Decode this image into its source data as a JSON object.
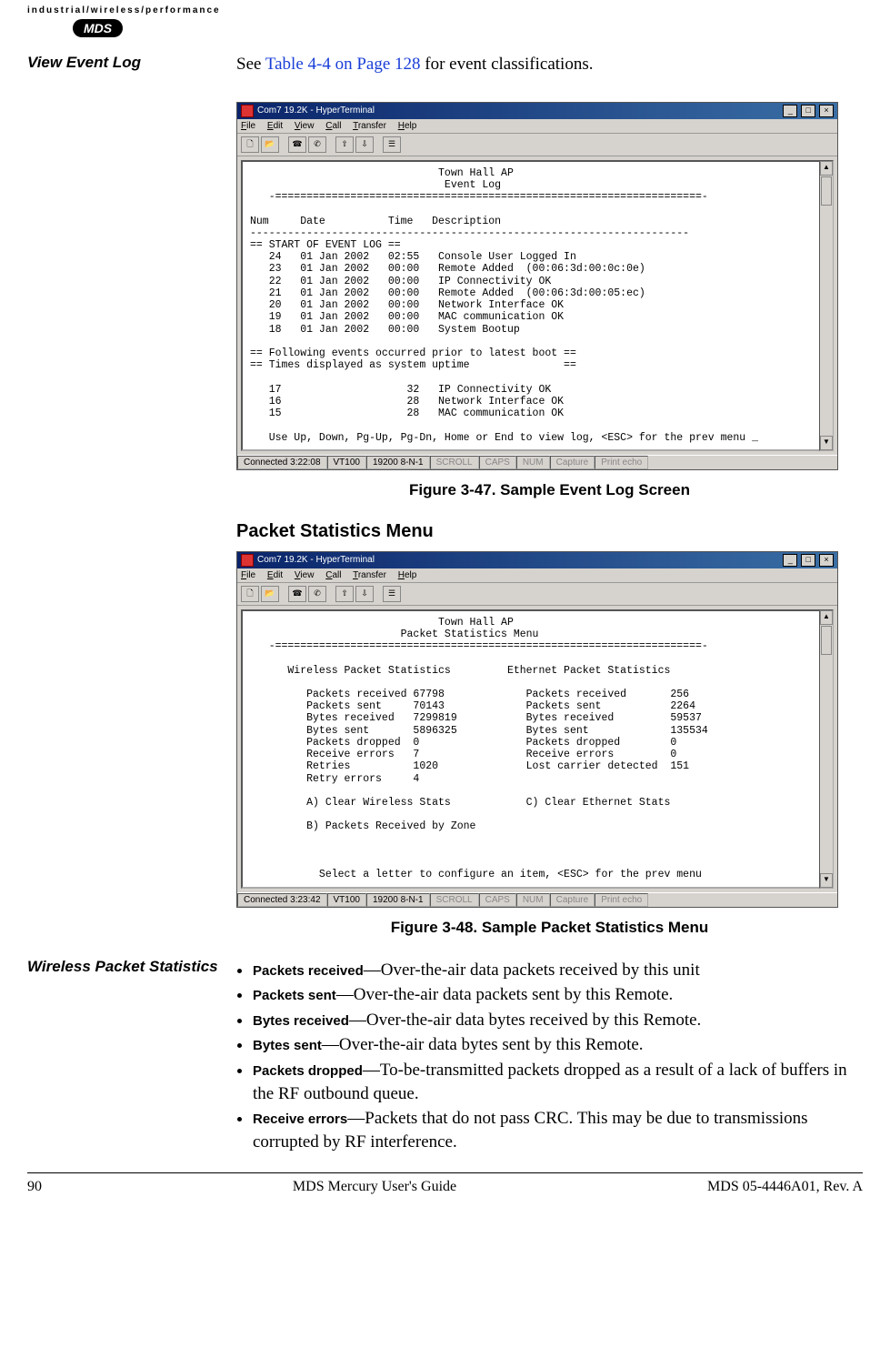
{
  "brand_line": "industrial/wireless/performance",
  "logo": "MDS",
  "side": {
    "view_event_log": "View Event Log",
    "wireless_packet_stats": "Wireless Packet Statistics"
  },
  "intro": {
    "see": "See ",
    "link": "Table 4-4 on Page 128",
    "rest": " for event classifications."
  },
  "window": {
    "title": "Com7 19.2K - HyperTerminal",
    "menu": {
      "file": "File",
      "edit": "Edit",
      "view": "View",
      "call": "Call",
      "transfer": "Transfer",
      "help": "Help"
    },
    "win_btns": {
      "min": "_",
      "max": "□",
      "close": "×"
    },
    "scroll": {
      "up": "▲",
      "down": "▼"
    }
  },
  "status1": {
    "conn": "Connected 3:22:08",
    "emu": "VT100",
    "port": "19200 8-N-1",
    "scroll": "SCROLL",
    "caps": "CAPS",
    "num": "NUM",
    "capture": "Capture",
    "echo": "Print echo"
  },
  "status2": {
    "conn": "Connected 3:23:42",
    "emu": "VT100",
    "port": "19200 8-N-1",
    "scroll": "SCROLL",
    "caps": "CAPS",
    "num": "NUM",
    "capture": "Capture",
    "echo": "Print echo"
  },
  "event_log_screen": "                              Town Hall AP\n                               Event Log\n   -====================================================================-\n\nNum     Date          Time   Description\n----------------------------------------------------------------------\n== START OF EVENT LOG ==\n   24   01 Jan 2002   02:55   Console User Logged In\n   23   01 Jan 2002   00:00   Remote Added  (00:06:3d:00:0c:0e)\n   22   01 Jan 2002   00:00   IP Connectivity OK\n   21   01 Jan 2002   00:00   Remote Added  (00:06:3d:00:05:ec)\n   20   01 Jan 2002   00:00   Network Interface OK\n   19   01 Jan 2002   00:00   MAC communication OK\n   18   01 Jan 2002   00:00   System Bootup\n\n== Following events occurred prior to latest boot ==\n== Times displayed as system uptime               ==\n\n   17                    32   IP Connectivity OK\n   16                    28   Network Interface OK\n   15                    28   MAC communication OK\n\n   Use Up, Down, Pg-Up, Pg-Dn, Home or End to view log, <ESC> for the prev menu _",
  "figure1_caption": "Figure 3-47. Sample Event Log Screen",
  "section_packet": "Packet Statistics Menu",
  "packet_stats_screen": "                              Town Hall AP\n                        Packet Statistics Menu\n   -====================================================================-\n\n      Wireless Packet Statistics         Ethernet Packet Statistics\n\n         Packets received 67798             Packets received       256\n         Packets sent     70143             Packets sent           2264\n         Bytes received   7299819           Bytes received         59537\n         Bytes sent       5896325           Bytes sent             135534\n         Packets dropped  0                 Packets dropped        0\n         Receive errors   7                 Receive errors         0\n         Retries          1020              Lost carrier detected  151\n         Retry errors     4\n\n         A) Clear Wireless Stats            C) Clear Ethernet Stats\n\n         B) Packets Received by Zone\n\n\n\n           Select a letter to configure an item, <ESC> for the prev menu",
  "figure2_caption": "Figure 3-48. Sample Packet Statistics Menu",
  "bullets": [
    {
      "term": "Packets received",
      "desc": "—Over-the-air data packets received by this unit"
    },
    {
      "term": "Packets sent",
      "desc": "—Over-the-air data packets sent by this Remote."
    },
    {
      "term": "Bytes received",
      "desc": "—Over-the-air data bytes received by this Remote."
    },
    {
      "term": "Bytes sent",
      "desc": "—Over-the-air data bytes sent by this Remote."
    },
    {
      "term": "Packets dropped",
      "desc": "—To-be-transmitted packets dropped as a result of a lack of buffers in the RF outbound queue."
    },
    {
      "term": "Receive errors",
      "desc": "—Packets that do not pass CRC. This may be due to transmissions corrupted by RF interference."
    }
  ],
  "chart_data": {
    "type": "table",
    "title": "Packet Statistics Menu — Town Hall AP",
    "series": [
      {
        "name": "Wireless Packet Statistics",
        "rows": [
          {
            "metric": "Packets received",
            "value": 67798
          },
          {
            "metric": "Packets sent",
            "value": 70143
          },
          {
            "metric": "Bytes received",
            "value": 7299819
          },
          {
            "metric": "Bytes sent",
            "value": 5896325
          },
          {
            "metric": "Packets dropped",
            "value": 0
          },
          {
            "metric": "Receive errors",
            "value": 7
          },
          {
            "metric": "Retries",
            "value": 1020
          },
          {
            "metric": "Retry errors",
            "value": 4
          }
        ]
      },
      {
        "name": "Ethernet Packet Statistics",
        "rows": [
          {
            "metric": "Packets received",
            "value": 256
          },
          {
            "metric": "Packets sent",
            "value": 2264
          },
          {
            "metric": "Bytes received",
            "value": 59537
          },
          {
            "metric": "Bytes sent",
            "value": 135534
          },
          {
            "metric": "Packets dropped",
            "value": 0
          },
          {
            "metric": "Receive errors",
            "value": 0
          },
          {
            "metric": "Lost carrier detected",
            "value": 151
          }
        ]
      }
    ]
  },
  "footer": {
    "page": "90",
    "center": "MDS Mercury User's Guide",
    "right": "MDS 05-4446A01, Rev. A"
  }
}
